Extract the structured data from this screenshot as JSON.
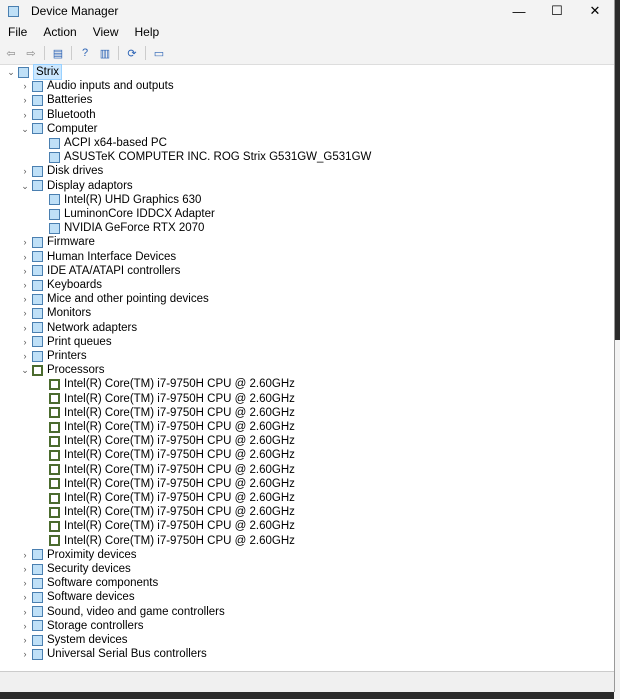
{
  "window": {
    "title": "Device Manager",
    "minimize": "—",
    "maximize": "☐",
    "close": "✕"
  },
  "menu": [
    "File",
    "Action",
    "View",
    "Help"
  ],
  "toolbar": [
    {
      "name": "back-icon",
      "g": "⇦"
    },
    {
      "name": "forward-icon",
      "g": "⇨"
    },
    {
      "name": "properties-icon",
      "g": "▤"
    },
    {
      "name": "help-icon",
      "g": "?"
    },
    {
      "name": "update-driver-icon",
      "g": "▥"
    },
    {
      "name": "scan-hardware-icon",
      "g": "⟳"
    },
    {
      "name": "monitor-icon",
      "g": "▭"
    }
  ],
  "tree": {
    "root": "Strix",
    "items": [
      {
        "label": "Audio inputs and outputs",
        "level": 1,
        "expanded": false
      },
      {
        "label": "Batteries",
        "level": 1,
        "expanded": false
      },
      {
        "label": "Bluetooth",
        "level": 1,
        "expanded": false
      },
      {
        "label": "Computer",
        "level": 1,
        "expanded": true
      },
      {
        "label": "ACPI x64-based PC",
        "level": 2
      },
      {
        "label": "ASUSTeK COMPUTER INC. ROG Strix G531GW_G531GW",
        "level": 2
      },
      {
        "label": "Disk drives",
        "level": 1,
        "expanded": false
      },
      {
        "label": "Display adaptors",
        "level": 1,
        "expanded": true
      },
      {
        "label": "Intel(R) UHD Graphics 630",
        "level": 2
      },
      {
        "label": "LuminonCore IDDCX Adapter",
        "level": 2
      },
      {
        "label": "NVIDIA GeForce RTX 2070",
        "level": 2
      },
      {
        "label": "Firmware",
        "level": 1,
        "expanded": false
      },
      {
        "label": "Human Interface Devices",
        "level": 1,
        "expanded": false
      },
      {
        "label": "IDE ATA/ATAPI controllers",
        "level": 1,
        "expanded": false
      },
      {
        "label": "Keyboards",
        "level": 1,
        "expanded": false
      },
      {
        "label": "Mice and other pointing devices",
        "level": 1,
        "expanded": false
      },
      {
        "label": "Monitors",
        "level": 1,
        "expanded": false
      },
      {
        "label": "Network adapters",
        "level": 1,
        "expanded": false
      },
      {
        "label": "Print queues",
        "level": 1,
        "expanded": false
      },
      {
        "label": "Printers",
        "level": 1,
        "expanded": false
      },
      {
        "label": "Processors",
        "level": 1,
        "expanded": true,
        "cpu": true
      },
      {
        "label": "Intel(R) Core(TM) i7-9750H CPU @ 2.60GHz",
        "level": 2,
        "cpu": true
      },
      {
        "label": "Intel(R) Core(TM) i7-9750H CPU @ 2.60GHz",
        "level": 2,
        "cpu": true
      },
      {
        "label": "Intel(R) Core(TM) i7-9750H CPU @ 2.60GHz",
        "level": 2,
        "cpu": true
      },
      {
        "label": "Intel(R) Core(TM) i7-9750H CPU @ 2.60GHz",
        "level": 2,
        "cpu": true
      },
      {
        "label": "Intel(R) Core(TM) i7-9750H CPU @ 2.60GHz",
        "level": 2,
        "cpu": true
      },
      {
        "label": "Intel(R) Core(TM) i7-9750H CPU @ 2.60GHz",
        "level": 2,
        "cpu": true
      },
      {
        "label": "Intel(R) Core(TM) i7-9750H CPU @ 2.60GHz",
        "level": 2,
        "cpu": true
      },
      {
        "label": "Intel(R) Core(TM) i7-9750H CPU @ 2.60GHz",
        "level": 2,
        "cpu": true
      },
      {
        "label": "Intel(R) Core(TM) i7-9750H CPU @ 2.60GHz",
        "level": 2,
        "cpu": true
      },
      {
        "label": "Intel(R) Core(TM) i7-9750H CPU @ 2.60GHz",
        "level": 2,
        "cpu": true
      },
      {
        "label": "Intel(R) Core(TM) i7-9750H CPU @ 2.60GHz",
        "level": 2,
        "cpu": true
      },
      {
        "label": "Intel(R) Core(TM) i7-9750H CPU @ 2.60GHz",
        "level": 2,
        "cpu": true
      },
      {
        "label": "Proximity devices",
        "level": 1,
        "expanded": false
      },
      {
        "label": "Security devices",
        "level": 1,
        "expanded": false
      },
      {
        "label": "Software components",
        "level": 1,
        "expanded": false
      },
      {
        "label": "Software devices",
        "level": 1,
        "expanded": false
      },
      {
        "label": "Sound, video and game controllers",
        "level": 1,
        "expanded": false
      },
      {
        "label": "Storage controllers",
        "level": 1,
        "expanded": false
      },
      {
        "label": "System devices",
        "level": 1,
        "expanded": false
      },
      {
        "label": "Universal Serial Bus controllers",
        "level": 1,
        "expanded": false
      }
    ]
  }
}
